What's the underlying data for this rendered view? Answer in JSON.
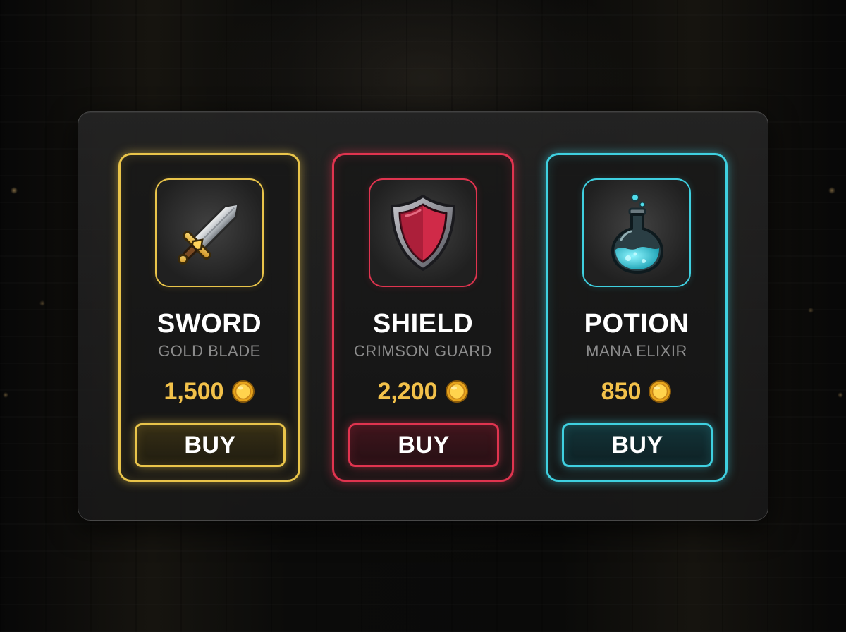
{
  "shop": {
    "items": [
      {
        "name": "SWORD",
        "subtitle": "GOLD BLADE",
        "price": "1,500",
        "currency_icon": "gold-coin-icon",
        "icon": "sword-icon",
        "button_label": "BUY",
        "accent_color": "#e9c44a"
      },
      {
        "name": "SHIELD",
        "subtitle": "CRIMSON GUARD",
        "price": "2,200",
        "currency_icon": "gold-coin-icon",
        "icon": "shield-icon",
        "button_label": "BUY",
        "accent_color": "#e0344f"
      },
      {
        "name": "POTION",
        "subtitle": "MANA ELIXIR",
        "price": "850",
        "currency_icon": "gold-coin-icon",
        "icon": "potion-flask-icon",
        "button_label": "BUY",
        "accent_color": "#3fd0e0"
      }
    ],
    "price_color": "#f2c14a"
  }
}
